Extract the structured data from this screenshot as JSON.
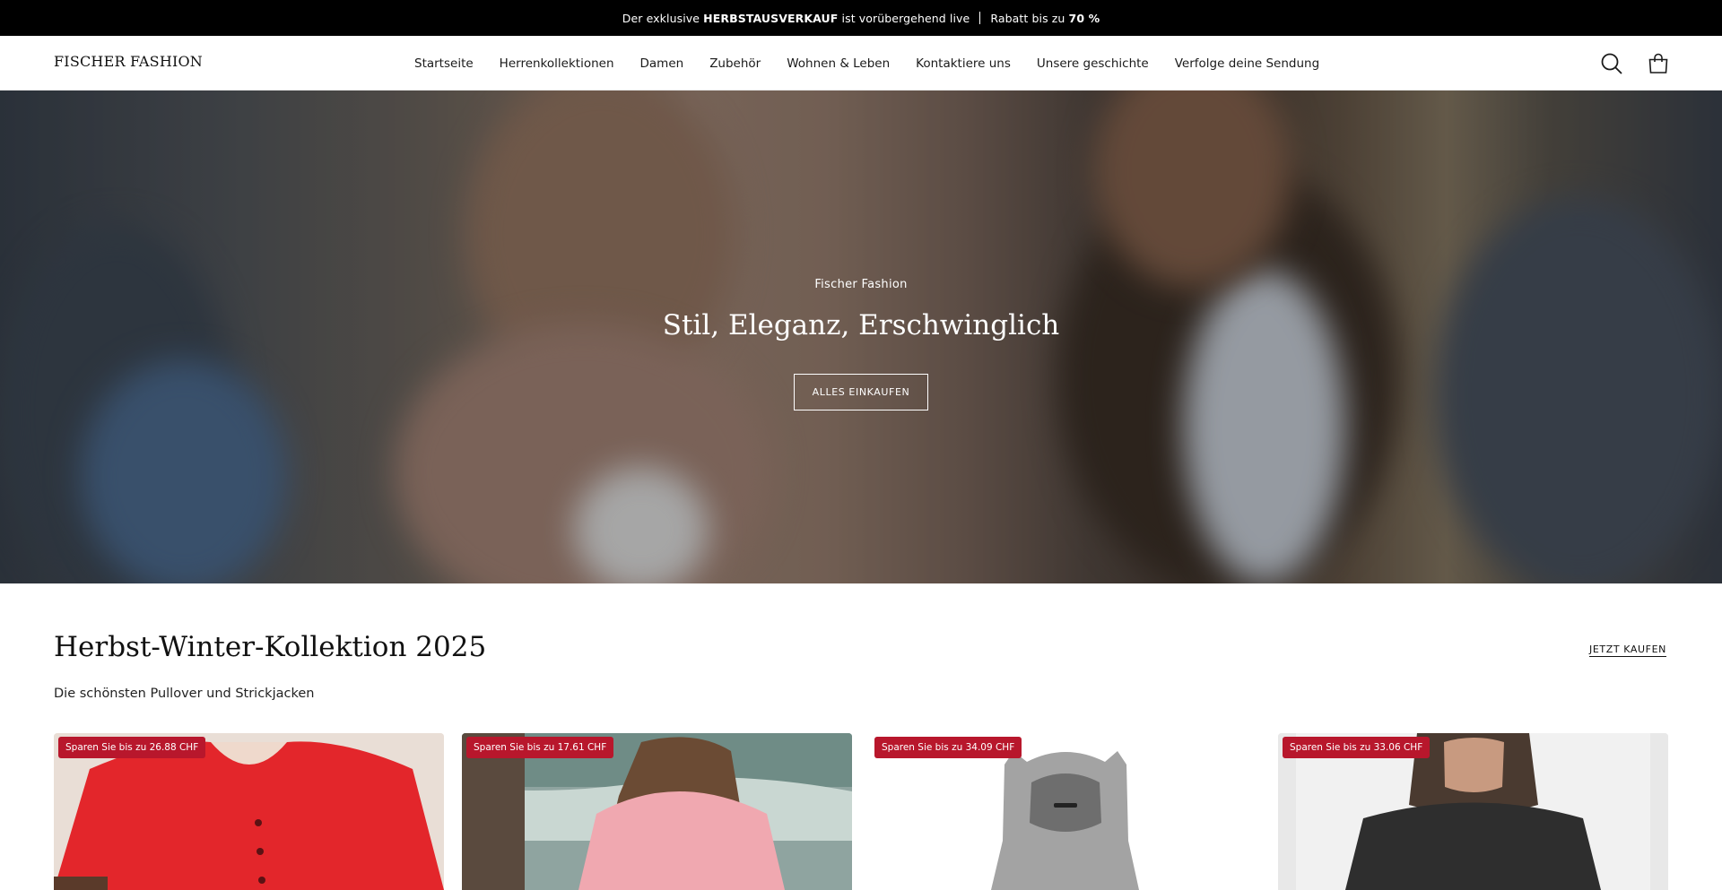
{
  "announcement": {
    "part1": "Der exklusive ",
    "bold1": "HERBSTAUSVERKAUF",
    "part2": " ist vorübergehend live",
    "part3": "Rabatt bis zu ",
    "bold2": "70 %"
  },
  "header": {
    "logo": "FISCHER FASHION",
    "nav": [
      "Startseite",
      "Herrenkollektionen",
      "Damen",
      "Zubehör",
      "Wohnen & Leben",
      "Kontaktiere uns",
      "Unsere geschichte",
      "Verfolge deine Sendung"
    ],
    "icons": [
      "search-icon",
      "shopping-bag-icon"
    ]
  },
  "hero": {
    "kicker": "Fischer Fashion",
    "title": "Stil, Eleganz, Erschwinglich",
    "button": "ALLES EINKAUFEN"
  },
  "collection": {
    "title": "Herbst-Winter-Kollektion 2025",
    "link": "JETZT KAUFEN",
    "subtitle": "Die schönsten Pullover und Strickjacken",
    "products": [
      {
        "badge": "Sparen Sie bis zu 26.88 CHF"
      },
      {
        "badge": "Sparen Sie bis zu 17.61 CHF"
      },
      {
        "badge": "Sparen Sie bis zu 34.09 CHF"
      },
      {
        "badge": "Sparen Sie bis zu 33.06 CHF"
      }
    ]
  },
  "colors": {
    "announcement_bg": "#000000",
    "badge_bg": "#b8172c",
    "text": "#1a1a1a"
  }
}
